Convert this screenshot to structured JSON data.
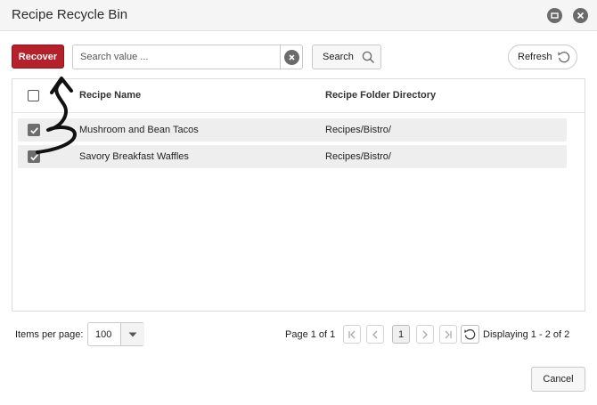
{
  "window": {
    "title": "Recipe Recycle Bin"
  },
  "toolbar": {
    "recover_label": "Recover",
    "search_placeholder": "Search value ...",
    "search_value": "",
    "search_label": "Search",
    "refresh_label": "Refresh"
  },
  "grid": {
    "columns": [
      "Recipe Name",
      "Recipe Folder Directory"
    ],
    "rows": [
      {
        "name": "Mushroom and Bean Tacos",
        "directory": "Recipes/Bistro/",
        "checked": true
      },
      {
        "name": "Savory Breakfast Waffles",
        "directory": "Recipes/Bistro/",
        "checked": true
      }
    ]
  },
  "pager": {
    "items_per_page_label": "Items per page:",
    "page_size": "100",
    "page_info": "Page 1 of 1",
    "current_page": "1",
    "displaying": "Displaying 1 - 2 of 2"
  },
  "footer": {
    "cancel_label": "Cancel"
  },
  "icons": {
    "restore": "window-restore-icon",
    "close": "close-icon",
    "clear": "clear-search-icon",
    "search": "search-icon",
    "refresh": "refresh-icon",
    "check": "check-icon"
  },
  "colors": {
    "accent": "#b5202a"
  }
}
